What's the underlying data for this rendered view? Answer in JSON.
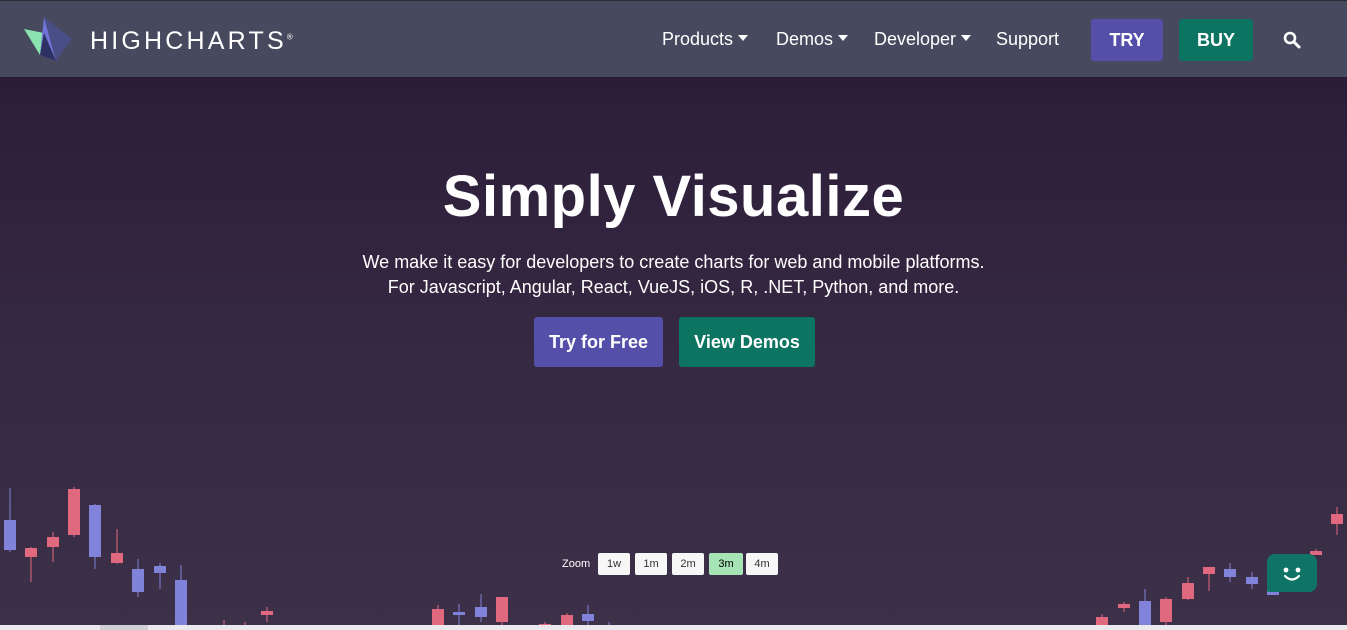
{
  "brand": {
    "name": "HIGHCHARTS",
    "trademark": "®",
    "colors": {
      "nav_bg": "#474a5e",
      "purple": "#544fa9",
      "teal": "#0d7462"
    }
  },
  "nav": {
    "items": [
      {
        "label": "Products",
        "dropdown": true
      },
      {
        "label": "Demos",
        "dropdown": true
      },
      {
        "label": "Developer",
        "dropdown": true
      },
      {
        "label": "Support",
        "dropdown": false
      }
    ],
    "try_label": "TRY",
    "buy_label": "BUY",
    "search_icon": "search-icon"
  },
  "hero": {
    "title": "Simply Visualize",
    "subtitle_line1": "We make it easy for developers to create charts for web and mobile platforms.",
    "subtitle_line2": "For Javascript, Angular, React, VueJS, iOS, R, .NET, Python, and more.",
    "cta_primary": "Try for Free",
    "cta_secondary": "View Demos"
  },
  "stock_chart": {
    "zoom_label": "Zoom",
    "zoom_buttons": [
      "1w",
      "1m",
      "2m",
      "3m",
      "4m"
    ],
    "zoom_selected": "3m",
    "up_color": "#8083d9",
    "down_color": "#e0697f"
  },
  "chat_widget": {
    "icon": "chat-bot-icon"
  }
}
